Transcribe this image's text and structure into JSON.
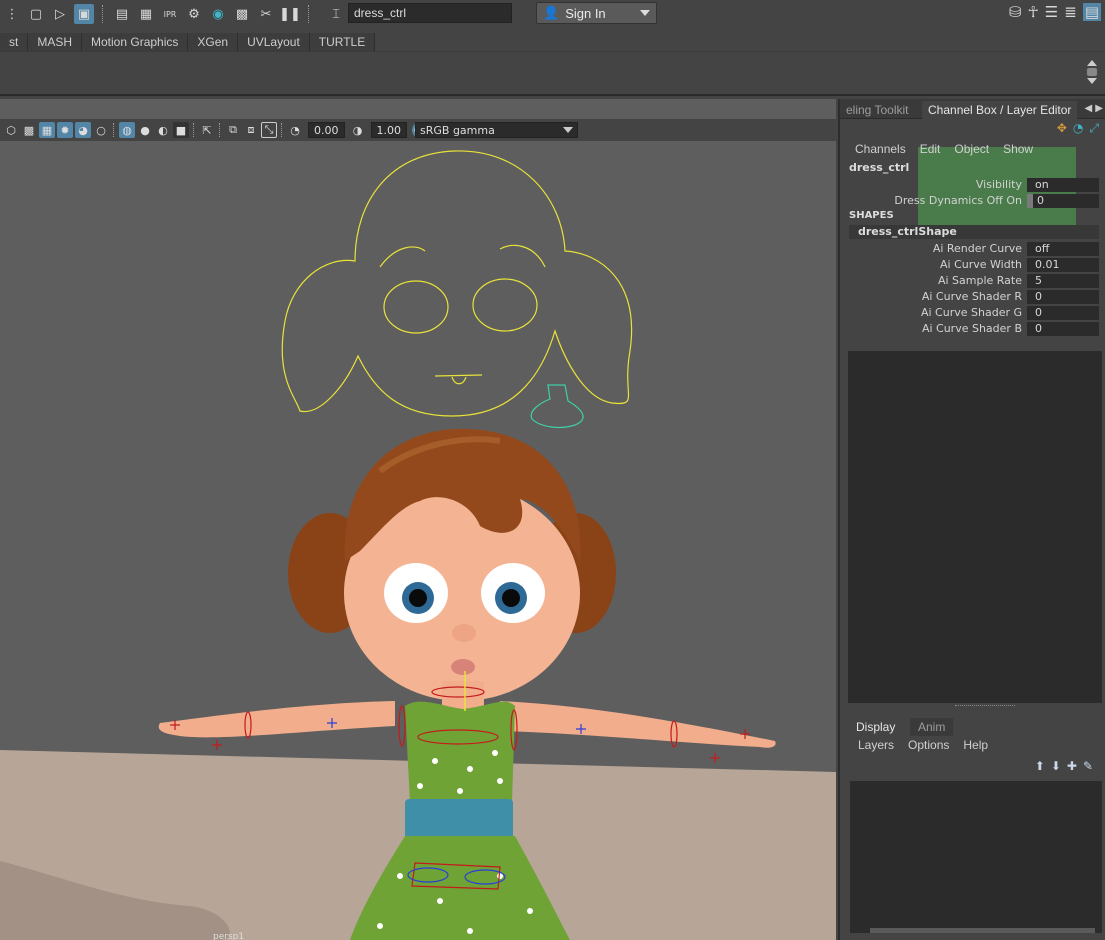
{
  "topbar": {
    "name_field_value": "dress_ctrl",
    "signin_label": "Sign In",
    "left_icons": [
      "new-scene-icon",
      "open-scene-icon",
      "save-scene-icon",
      "render-view-icon",
      "render-icon",
      "ipr-render-icon",
      "render-settings-icon",
      "hypershade-icon",
      "render-setup-icon",
      "light-editor-icon",
      "pause-icon",
      "input-field-icon"
    ],
    "right_icons": [
      "modeling-toolkit-icon",
      "human-ik-icon",
      "attribute-editor-icon",
      "tool-settings-icon",
      "channel-box-icon"
    ]
  },
  "shelf": {
    "tabs": [
      "st",
      "MASH",
      "Motion Graphics",
      "XGen",
      "UVLayout",
      "TURTLE"
    ]
  },
  "viewport": {
    "exposure_value": "0.00",
    "gamma_value": "1.00",
    "color_space": "sRGB gamma",
    "camera_label": "persp1",
    "colors": {
      "background": "#5e5e5e",
      "floor": "#b7a697",
      "controller": "#e8e23a",
      "dress": "#6fa336",
      "skin": "#f4b494",
      "hair": "#8a4317"
    }
  },
  "right_panel": {
    "tabs": [
      "eling Toolkit",
      "Channel Box / Layer Editor"
    ],
    "menu": [
      "Channels",
      "Edit",
      "Object",
      "Show"
    ],
    "node": "dress_ctrl",
    "channels": [
      {
        "label": "Visibility",
        "value": "on"
      },
      {
        "label": "Dress Dynamics Off On",
        "value": "0"
      }
    ],
    "shapes_header": "SHAPES",
    "shape_name": "dress_ctrlShape",
    "shape_attrs": [
      {
        "label": "Ai Render Curve",
        "value": "off"
      },
      {
        "label": "Ai Curve Width",
        "value": "0.01"
      },
      {
        "label": "Ai Sample Rate",
        "value": "5"
      },
      {
        "label": "Ai Curve Shader R",
        "value": "0"
      },
      {
        "label": "Ai Curve Shader G",
        "value": "0"
      },
      {
        "label": "Ai Curve Shader B",
        "value": "0"
      }
    ],
    "layer_tabs": [
      "Display",
      "Anim"
    ],
    "layer_menu": [
      "Layers",
      "Options",
      "Help"
    ]
  }
}
